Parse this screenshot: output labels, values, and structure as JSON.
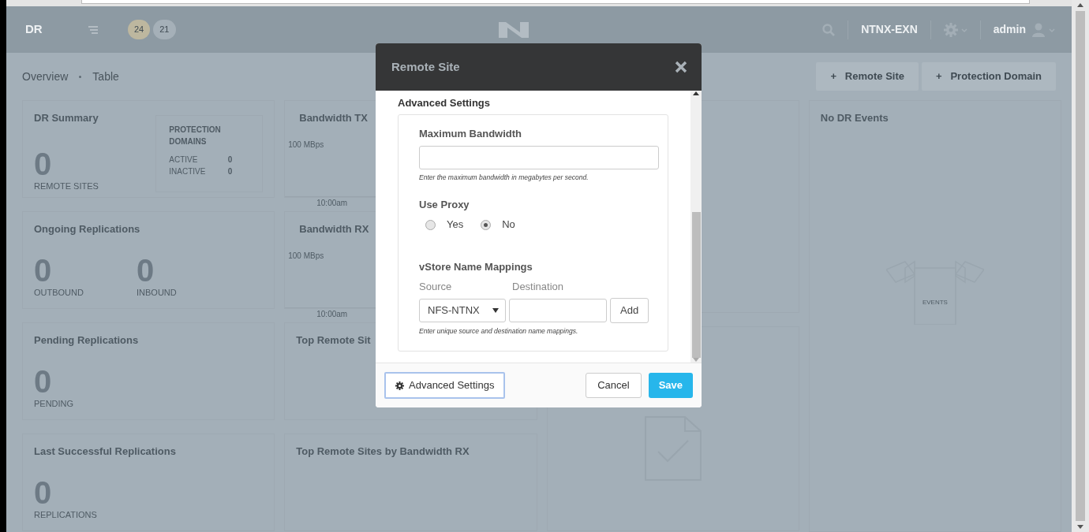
{
  "topbar": {
    "title": "DR",
    "badges": [
      {
        "text": "24",
        "color": "#bdb79f"
      },
      {
        "text": "21",
        "color": "#a5b0b8"
      }
    ],
    "cluster": "NTNX-EXN",
    "user": "admin"
  },
  "breadcrumb": [
    "Overview",
    "Table"
  ],
  "actions": [
    {
      "icon": "+",
      "label": "Remote Site"
    },
    {
      "icon": "+",
      "label": "Protection Domain"
    }
  ],
  "columns": [
    [
      {
        "kind": "summary",
        "title": "DR Summary",
        "stats": [
          {
            "value": "0",
            "label": "REMOTE SITES"
          }
        ],
        "panel": {
          "title": "PROTECTION DOMAINS",
          "rows": [
            {
              "label": "ACTIVE",
              "value": "0"
            },
            {
              "label": "INACTIVE",
              "value": "0"
            }
          ]
        }
      },
      {
        "kind": "stats",
        "title": "Ongoing Replications",
        "stats": [
          {
            "value": "0",
            "label": "OUTBOUND"
          },
          {
            "value": "0",
            "label": "INBOUND"
          }
        ]
      },
      {
        "kind": "stats",
        "title": "Pending Replications",
        "stats": [
          {
            "value": "0",
            "label": "PENDING"
          }
        ]
      },
      {
        "kind": "stats",
        "title": "Last Successful Replications",
        "stats": [
          {
            "value": "0",
            "label": "REPLICATIONS"
          }
        ]
      }
    ],
    [
      {
        "kind": "chart",
        "title": "Bandwidth TX",
        "y_text": "100 MBps",
        "x_text": "10:00am"
      },
      {
        "kind": "chart",
        "title": "Bandwidth RX",
        "y_text": "100 MBps",
        "x_text": "10:00am"
      },
      {
        "kind": "blank",
        "title": "Top Remote Sit"
      },
      {
        "kind": "blank",
        "title": "Top Remote Sites by Bandwidth RX"
      }
    ],
    [
      {
        "kind": "blank"
      },
      {
        "kind": "document"
      }
    ],
    [
      {
        "kind": "events",
        "title": "No DR Events",
        "caption": "EVENTS"
      }
    ]
  ],
  "modal": {
    "title": "Remote Site",
    "section_title": "Advanced Settings",
    "bandwidth": {
      "label": "Maximum Bandwidth",
      "help": "Enter the maximum bandwidth in megabytes per second."
    },
    "proxy": {
      "label": "Use Proxy",
      "options": [
        {
          "label": "Yes",
          "selected": false
        },
        {
          "label": "No",
          "selected": true
        }
      ]
    },
    "mappings": {
      "label": "vStore Name Mappings",
      "source_label": "Source",
      "destination_label": "Destination",
      "source_value": "NFS-NTNX",
      "add_button": "Add",
      "help": "Enter unique source and destination name mappings."
    },
    "footer": {
      "advanced_button": "Advanced Settings",
      "cancel": "Cancel",
      "save": "Save"
    }
  }
}
